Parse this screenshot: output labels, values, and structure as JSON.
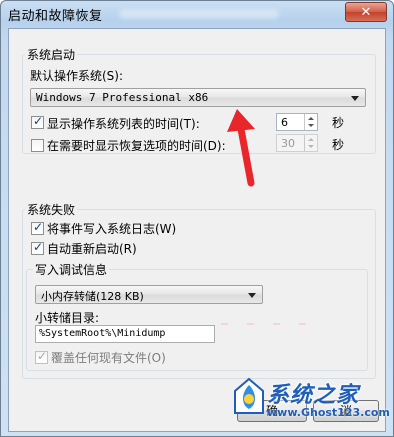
{
  "window": {
    "title": "启动和故障恢复",
    "close_symbol": "✕"
  },
  "system_startup": {
    "group_title": "系统启动",
    "default_os_label": "默认操作系统(S):",
    "default_os_value": "Windows 7 Professional x86",
    "show_os_list": {
      "label": "显示操作系统列表的时间(T):",
      "checked": true,
      "value": "6",
      "unit": "秒"
    },
    "show_recovery": {
      "label": "在需要时显示恢复选项的时间(D):",
      "checked": false,
      "value": "30",
      "unit": "秒"
    }
  },
  "system_failure": {
    "group_title": "系统失败",
    "write_event_log": {
      "label": "将事件写入系统日志(W)",
      "checked": true
    },
    "auto_restart": {
      "label": "自动重新启动(R)",
      "checked": true
    },
    "debug_info": {
      "group_title": "写入调试信息",
      "dump_type": "小内存转储(128 KB)",
      "dump_dir_label": "小转储目录:",
      "dump_dir_value": "%SystemRoot%\\Minidump",
      "overwrite": {
        "label": "覆盖任何现有文件(O)",
        "checked": true,
        "disabled": true
      }
    }
  },
  "buttons": {
    "ok_partial": "确",
    "cancel_partial": "消"
  },
  "watermark": {
    "brand": "系统之家",
    "url": "www.Ghost123.com"
  },
  "colors": {
    "annotation_arrow": "#e8262b",
    "brand_blue": "#1f5fb8"
  }
}
